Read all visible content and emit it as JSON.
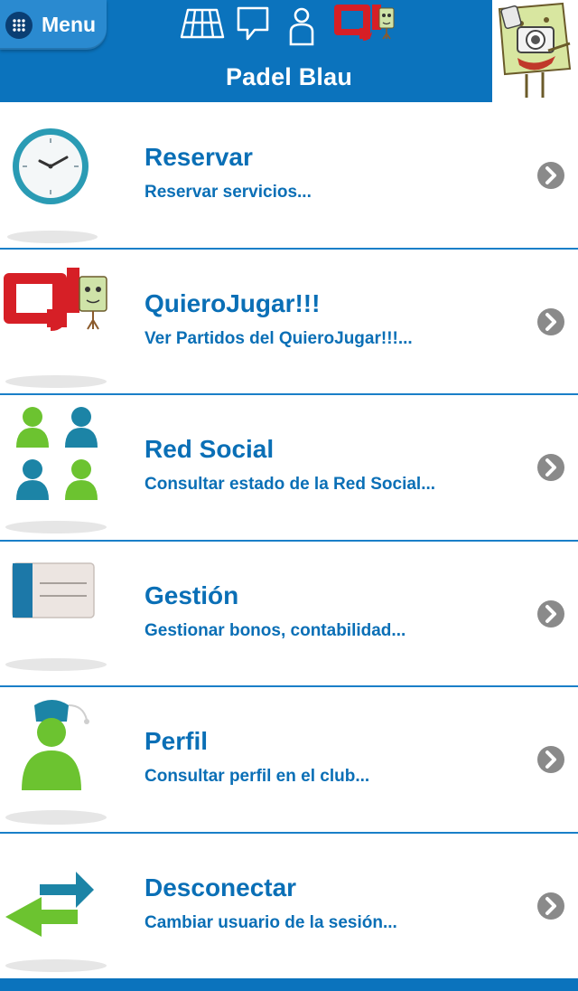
{
  "header": {
    "menu_label": "Menu",
    "title": "Padel Blau",
    "icons": [
      "court-icon",
      "chat-icon",
      "user-icon",
      "quierojugar-logo-icon"
    ],
    "bg_color": "#0b73bd"
  },
  "rows": [
    {
      "title": "Reservar",
      "subtitle": "Reservar servicios...",
      "icon": "clock-icon"
    },
    {
      "title": "QuieroJugar!!!",
      "subtitle": "Ver Partidos del QuieroJugar!!!...",
      "icon": "quierojugar-logo-icon"
    },
    {
      "title": "Red Social",
      "subtitle": "Consultar estado de la Red Social...",
      "icon": "people-icon"
    },
    {
      "title": "Gestión",
      "subtitle": "Gestionar bonos, contabilidad...",
      "icon": "card-icon"
    },
    {
      "title": "Perfil",
      "subtitle": "Consultar perfil en el club...",
      "icon": "profile-icon"
    },
    {
      "title": "Desconectar",
      "subtitle": "Cambiar usuario de la sesión...",
      "icon": "swap-arrows-icon"
    }
  ],
  "colors": {
    "accent": "#0b73bd",
    "text": "#0a6fb6",
    "chevron": "#8a8a8a"
  }
}
